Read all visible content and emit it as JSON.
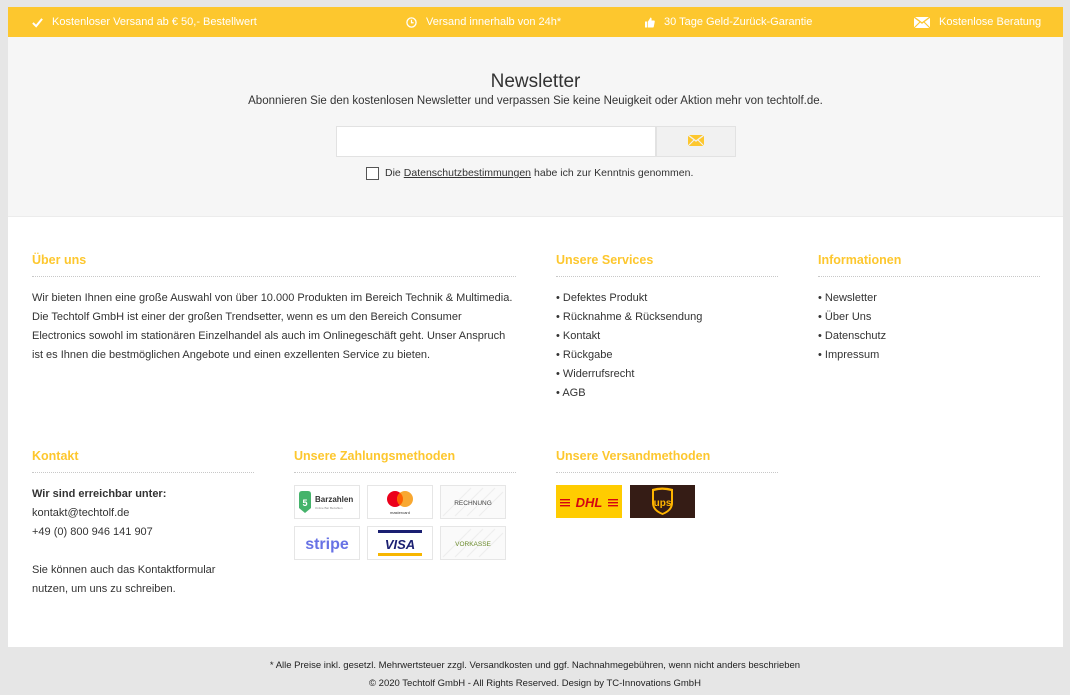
{
  "colors": {
    "accent": "#fdc72e",
    "usp_text": "#ffffff"
  },
  "usp_bar": [
    {
      "icon": "check-icon",
      "label": "Kostenloser Versand ab € 50,- Bestellwert"
    },
    {
      "icon": "clock-icon",
      "label": "Versand innerhalb von 24h*"
    },
    {
      "icon": "thumbs-up-icon",
      "label": "30 Tage Geld-Zurück-Garantie"
    },
    {
      "icon": "envelope-icon",
      "label": "Kostenlose Beratung"
    }
  ],
  "newsletter": {
    "title": "Newsletter",
    "subtitle": "Abonnieren Sie den kostenlosen Newsletter und verpassen Sie keine Neuigkeit oder Aktion mehr von techtolf.de.",
    "input_value": "",
    "input_placeholder": "",
    "submit_icon": "envelope-icon",
    "consent_prefix": "Die",
    "consent_link": "Datenschutzbestimmungen",
    "consent_suffix": "habe ich zur Kenntnis genommen."
  },
  "about": {
    "heading": "Über uns",
    "text": "Wir bieten Ihnen eine große Auswahl von über 10.000 Produkten im Bereich Technik & Multimedia. Die Techtolf GmbH ist einer der großen Trendsetter, wenn es um den Bereich Consumer Electronics sowohl im stationären Einzelhandel als auch im Onlinegeschäft geht. Unser Anspruch ist es Ihnen die bestmöglichen Angebote und einen exzellenten Service zu bieten."
  },
  "services": {
    "heading": "Unsere Services",
    "items": [
      "Defektes Produkt",
      "Rücknahme & Rücksendung",
      "Kontakt",
      "Rückgabe",
      "Widerrufsrecht",
      "AGB"
    ]
  },
  "information": {
    "heading": "Informationen",
    "items": [
      "Newsletter",
      "Über Uns",
      "Datenschutz",
      "Impressum"
    ]
  },
  "contact": {
    "heading": "Kontakt",
    "reachable": "Wir sind erreichbar unter:",
    "email": "kontakt@techtolf.de",
    "phone": "+49 (0) 800 946 141 907",
    "note": "Sie können auch das Kontaktformular nutzen, um uns zu schreiben."
  },
  "payment": {
    "heading": "Unsere Zahlungsmethoden",
    "methods": [
      {
        "name": "Barzahlen",
        "caption": "Online Bar Bezahlen"
      },
      {
        "name": "mastercard"
      },
      {
        "name": "RECHNUNG"
      },
      {
        "name": "stripe"
      },
      {
        "name": "VISA"
      },
      {
        "name": "VORKASSE"
      }
    ]
  },
  "shipping": {
    "heading": "Unsere Versandmethoden",
    "methods": [
      {
        "name": "DHL"
      },
      {
        "name": "ups"
      }
    ]
  },
  "bottom": {
    "tax_note": "* Alle Preise inkl. gesetzl. Mehrwertsteuer zzgl. Versandkosten und ggf. Nachnahmegebühren, wenn nicht anders beschrieben",
    "copyright": "© 2020 Techtolf GmbH - All Rights Reserved. Design by TC-Innovations GmbH"
  }
}
